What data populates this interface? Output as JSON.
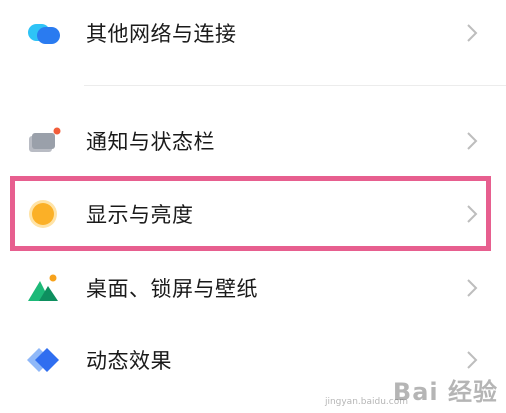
{
  "settings": {
    "items": [
      {
        "label": "其他网络与连接",
        "icon": "cloud-network-icon"
      },
      {
        "label": "通知与状态栏",
        "icon": "notification-card-icon"
      },
      {
        "label": "显示与亮度",
        "icon": "brightness-sun-icon"
      },
      {
        "label": "桌面、锁屏与壁纸",
        "icon": "wallpaper-mountain-icon"
      },
      {
        "label": "动态效果",
        "icon": "motion-diamond-icon"
      }
    ]
  },
  "highlight_color": "#e75f8f",
  "watermark": {
    "main": "Bai 经验",
    "sub": "jingyan.baidu.com"
  }
}
